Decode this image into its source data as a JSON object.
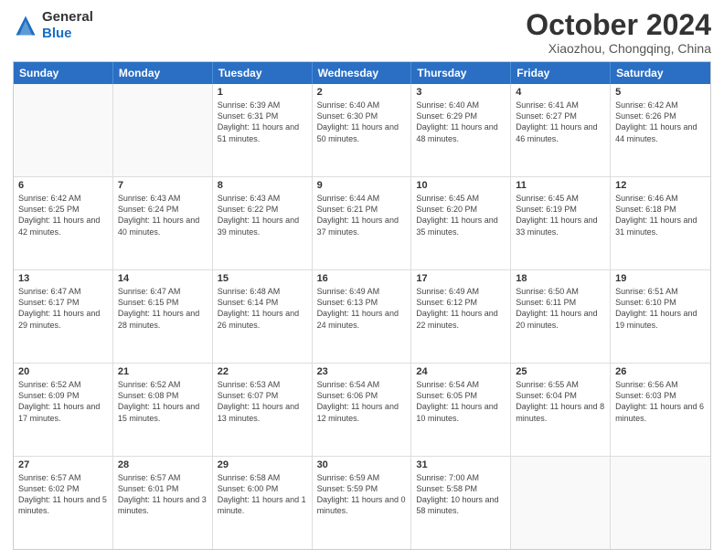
{
  "header": {
    "logo_general": "General",
    "logo_blue": "Blue",
    "month_title": "October 2024",
    "location": "Xiaozhou, Chongqing, China"
  },
  "days_of_week": [
    "Sunday",
    "Monday",
    "Tuesday",
    "Wednesday",
    "Thursday",
    "Friday",
    "Saturday"
  ],
  "rows": [
    [
      {
        "day": "",
        "sunrise": "",
        "sunset": "",
        "daylight": "",
        "empty": true
      },
      {
        "day": "",
        "sunrise": "",
        "sunset": "",
        "daylight": "",
        "empty": true
      },
      {
        "day": "1",
        "sunrise": "Sunrise: 6:39 AM",
        "sunset": "Sunset: 6:31 PM",
        "daylight": "Daylight: 11 hours and 51 minutes."
      },
      {
        "day": "2",
        "sunrise": "Sunrise: 6:40 AM",
        "sunset": "Sunset: 6:30 PM",
        "daylight": "Daylight: 11 hours and 50 minutes."
      },
      {
        "day": "3",
        "sunrise": "Sunrise: 6:40 AM",
        "sunset": "Sunset: 6:29 PM",
        "daylight": "Daylight: 11 hours and 48 minutes."
      },
      {
        "day": "4",
        "sunrise": "Sunrise: 6:41 AM",
        "sunset": "Sunset: 6:27 PM",
        "daylight": "Daylight: 11 hours and 46 minutes."
      },
      {
        "day": "5",
        "sunrise": "Sunrise: 6:42 AM",
        "sunset": "Sunset: 6:26 PM",
        "daylight": "Daylight: 11 hours and 44 minutes."
      }
    ],
    [
      {
        "day": "6",
        "sunrise": "Sunrise: 6:42 AM",
        "sunset": "Sunset: 6:25 PM",
        "daylight": "Daylight: 11 hours and 42 minutes."
      },
      {
        "day": "7",
        "sunrise": "Sunrise: 6:43 AM",
        "sunset": "Sunset: 6:24 PM",
        "daylight": "Daylight: 11 hours and 40 minutes."
      },
      {
        "day": "8",
        "sunrise": "Sunrise: 6:43 AM",
        "sunset": "Sunset: 6:22 PM",
        "daylight": "Daylight: 11 hours and 39 minutes."
      },
      {
        "day": "9",
        "sunrise": "Sunrise: 6:44 AM",
        "sunset": "Sunset: 6:21 PM",
        "daylight": "Daylight: 11 hours and 37 minutes."
      },
      {
        "day": "10",
        "sunrise": "Sunrise: 6:45 AM",
        "sunset": "Sunset: 6:20 PM",
        "daylight": "Daylight: 11 hours and 35 minutes."
      },
      {
        "day": "11",
        "sunrise": "Sunrise: 6:45 AM",
        "sunset": "Sunset: 6:19 PM",
        "daylight": "Daylight: 11 hours and 33 minutes."
      },
      {
        "day": "12",
        "sunrise": "Sunrise: 6:46 AM",
        "sunset": "Sunset: 6:18 PM",
        "daylight": "Daylight: 11 hours and 31 minutes."
      }
    ],
    [
      {
        "day": "13",
        "sunrise": "Sunrise: 6:47 AM",
        "sunset": "Sunset: 6:17 PM",
        "daylight": "Daylight: 11 hours and 29 minutes."
      },
      {
        "day": "14",
        "sunrise": "Sunrise: 6:47 AM",
        "sunset": "Sunset: 6:15 PM",
        "daylight": "Daylight: 11 hours and 28 minutes."
      },
      {
        "day": "15",
        "sunrise": "Sunrise: 6:48 AM",
        "sunset": "Sunset: 6:14 PM",
        "daylight": "Daylight: 11 hours and 26 minutes."
      },
      {
        "day": "16",
        "sunrise": "Sunrise: 6:49 AM",
        "sunset": "Sunset: 6:13 PM",
        "daylight": "Daylight: 11 hours and 24 minutes."
      },
      {
        "day": "17",
        "sunrise": "Sunrise: 6:49 AM",
        "sunset": "Sunset: 6:12 PM",
        "daylight": "Daylight: 11 hours and 22 minutes."
      },
      {
        "day": "18",
        "sunrise": "Sunrise: 6:50 AM",
        "sunset": "Sunset: 6:11 PM",
        "daylight": "Daylight: 11 hours and 20 minutes."
      },
      {
        "day": "19",
        "sunrise": "Sunrise: 6:51 AM",
        "sunset": "Sunset: 6:10 PM",
        "daylight": "Daylight: 11 hours and 19 minutes."
      }
    ],
    [
      {
        "day": "20",
        "sunrise": "Sunrise: 6:52 AM",
        "sunset": "Sunset: 6:09 PM",
        "daylight": "Daylight: 11 hours and 17 minutes."
      },
      {
        "day": "21",
        "sunrise": "Sunrise: 6:52 AM",
        "sunset": "Sunset: 6:08 PM",
        "daylight": "Daylight: 11 hours and 15 minutes."
      },
      {
        "day": "22",
        "sunrise": "Sunrise: 6:53 AM",
        "sunset": "Sunset: 6:07 PM",
        "daylight": "Daylight: 11 hours and 13 minutes."
      },
      {
        "day": "23",
        "sunrise": "Sunrise: 6:54 AM",
        "sunset": "Sunset: 6:06 PM",
        "daylight": "Daylight: 11 hours and 12 minutes."
      },
      {
        "day": "24",
        "sunrise": "Sunrise: 6:54 AM",
        "sunset": "Sunset: 6:05 PM",
        "daylight": "Daylight: 11 hours and 10 minutes."
      },
      {
        "day": "25",
        "sunrise": "Sunrise: 6:55 AM",
        "sunset": "Sunset: 6:04 PM",
        "daylight": "Daylight: 11 hours and 8 minutes."
      },
      {
        "day": "26",
        "sunrise": "Sunrise: 6:56 AM",
        "sunset": "Sunset: 6:03 PM",
        "daylight": "Daylight: 11 hours and 6 minutes."
      }
    ],
    [
      {
        "day": "27",
        "sunrise": "Sunrise: 6:57 AM",
        "sunset": "Sunset: 6:02 PM",
        "daylight": "Daylight: 11 hours and 5 minutes."
      },
      {
        "day": "28",
        "sunrise": "Sunrise: 6:57 AM",
        "sunset": "Sunset: 6:01 PM",
        "daylight": "Daylight: 11 hours and 3 minutes."
      },
      {
        "day": "29",
        "sunrise": "Sunrise: 6:58 AM",
        "sunset": "Sunset: 6:00 PM",
        "daylight": "Daylight: 11 hours and 1 minute."
      },
      {
        "day": "30",
        "sunrise": "Sunrise: 6:59 AM",
        "sunset": "Sunset: 5:59 PM",
        "daylight": "Daylight: 11 hours and 0 minutes."
      },
      {
        "day": "31",
        "sunrise": "Sunrise: 7:00 AM",
        "sunset": "Sunset: 5:58 PM",
        "daylight": "Daylight: 10 hours and 58 minutes."
      },
      {
        "day": "",
        "sunrise": "",
        "sunset": "",
        "daylight": "",
        "empty": true
      },
      {
        "day": "",
        "sunrise": "",
        "sunset": "",
        "daylight": "",
        "empty": true
      }
    ]
  ]
}
